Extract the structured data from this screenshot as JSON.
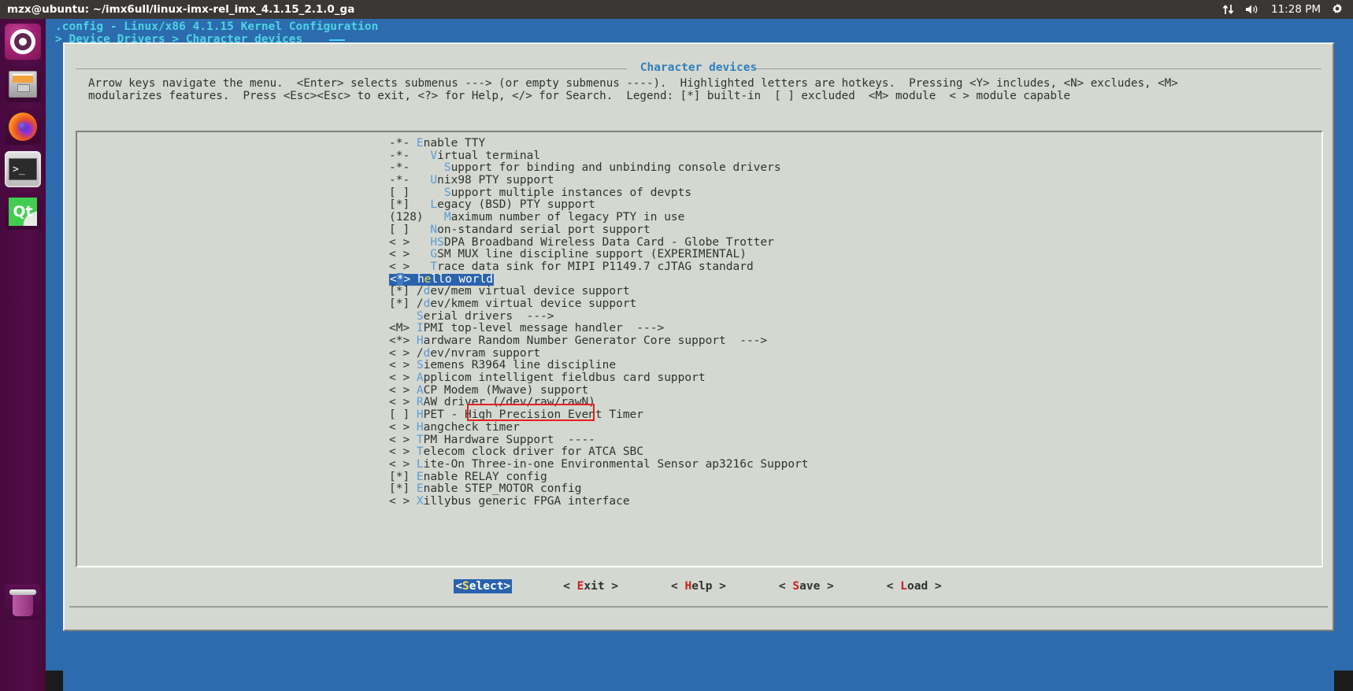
{
  "panel": {
    "window_title": "mzx@ubuntu: ~/imx6ull/linux-imx-rel_imx_4.1.15_2.1.0_ga",
    "clock": "11:28 PM",
    "network_icon": "network-updown-icon",
    "volume_icon": "volume-icon",
    "gear_icon": "gear-icon"
  },
  "launcher": {
    "items": [
      {
        "name": "ubuntu-dash",
        "label": "Ubuntu Dash",
        "icon": "ubuntu-logo-icon",
        "active": false
      },
      {
        "name": "files",
        "label": "Files",
        "icon": "file-cabinet-icon",
        "active": false
      },
      {
        "name": "firefox",
        "label": "Firefox",
        "icon": "firefox-icon",
        "active": false
      },
      {
        "name": "terminal",
        "label": "Terminal",
        "icon": "terminal-icon",
        "active": true,
        "prompt": ">_"
      },
      {
        "name": "qtcreator",
        "label": "Qt Creator",
        "icon": "qt-icon",
        "glyph": "Qt",
        "active": false
      },
      {
        "name": "trash",
        "label": "Trash",
        "icon": "trash-icon",
        "active": false
      }
    ]
  },
  "menuconfig": {
    "title": ".config - Linux/x86 4.1.15 Kernel Configuration",
    "breadcrumb": "> Device Drivers > Character devices",
    "dialog_title": "Character devices",
    "instructions_line1": "Arrow keys navigate the menu.  <Enter> selects submenus ---> (or empty submenus ----).  Highlighted letters are hotkeys.  Pressing <Y> includes, <N> excludes, <M>",
    "instructions_line2": "modularizes features.  Press <Esc><Esc> to exit, <?> for Help, </> for Search.  Legend: [*] built-in  [ ] excluded  <M> module  < > module capable",
    "rows": [
      {
        "flag": "-*- ",
        "indent": "",
        "hot": "E",
        "rest": "nable TTY"
      },
      {
        "flag": "-*- ",
        "indent": "  ",
        "hot": "V",
        "rest": "irtual terminal"
      },
      {
        "flag": "-*- ",
        "indent": "    ",
        "hot": "S",
        "rest": "upport for binding and unbinding console drivers"
      },
      {
        "flag": "-*- ",
        "indent": "  ",
        "hot": "U",
        "rest": "nix98 PTY support"
      },
      {
        "flag": "[ ] ",
        "indent": "    ",
        "hot": "S",
        "rest": "upport multiple instances of devpts"
      },
      {
        "flag": "[*] ",
        "indent": "  ",
        "hot": "L",
        "rest": "egacy (BSD) PTY support"
      },
      {
        "flag": "(128) ",
        "indent": "  ",
        "hot": "M",
        "rest": "aximum number of legacy PTY in use"
      },
      {
        "flag": "[ ] ",
        "indent": "  ",
        "hot": "N",
        "rest": "on-standard serial port support"
      },
      {
        "flag": "< > ",
        "indent": "  ",
        "hot": "HS",
        "rest": "DPA Broadband Wireless Data Card - Globe Trotter"
      },
      {
        "flag": "< > ",
        "indent": "  ",
        "hot": "G",
        "rest": "SM MUX line discipline support (EXPERIMENTAL)"
      },
      {
        "flag": "< > ",
        "indent": "  ",
        "hot": "T",
        "rest": "race data sink for MIPI P1149.7 cJTAG standard"
      },
      {
        "flag": "<*> ",
        "indent": "",
        "hot": "e",
        "pre": "h",
        "rest": "llo world",
        "selected": true,
        "label": "hello world"
      },
      {
        "flag": "[*] ",
        "indent": "",
        "pre": "/",
        "hot": "d",
        "rest": "ev/mem virtual device support"
      },
      {
        "flag": "[*] ",
        "indent": "",
        "pre": "/",
        "hot": "d",
        "rest": "ev/kmem virtual device support"
      },
      {
        "flag": "    ",
        "indent": "",
        "hot": "S",
        "rest": "erial drivers  --->"
      },
      {
        "flag": "<M> ",
        "indent": "",
        "hot": "I",
        "rest": "PMI top-level message handler  --->"
      },
      {
        "flag": "<*> ",
        "indent": "",
        "hot": "H",
        "rest": "ardware Random Number Generator Core support  --->"
      },
      {
        "flag": "< > ",
        "indent": "",
        "pre": "/",
        "hot": "d",
        "rest": "ev/nvram support"
      },
      {
        "flag": "< > ",
        "indent": "",
        "hot": "S",
        "rest": "iemens R3964 line discipline"
      },
      {
        "flag": "< > ",
        "indent": "",
        "hot": "A",
        "rest": "pplicom intelligent fieldbus card support"
      },
      {
        "flag": "< > ",
        "indent": "",
        "hot": "A",
        "rest": "CP Modem (Mwave) support"
      },
      {
        "flag": "< > ",
        "indent": "",
        "hot": "R",
        "rest": "AW driver (/dev/raw/rawN)"
      },
      {
        "flag": "[ ] ",
        "indent": "",
        "hot": "H",
        "rest": "PET - High Precision Event Timer"
      },
      {
        "flag": "< > ",
        "indent": "",
        "hot": "H",
        "rest": "angcheck timer"
      },
      {
        "flag": "< > ",
        "indent": "",
        "hot": "T",
        "rest": "PM Hardware Support  ----"
      },
      {
        "flag": "< > ",
        "indent": "",
        "hot": "T",
        "rest": "elecom clock driver for ATCA SBC"
      },
      {
        "flag": "< > ",
        "indent": "",
        "hot": "L",
        "rest": "ite-On Three-in-one Environmental Sensor ap3216c Support"
      },
      {
        "flag": "[*] ",
        "indent": "",
        "hot": "E",
        "rest": "nable RELAY config"
      },
      {
        "flag": "[*] ",
        "indent": "",
        "hot": "E",
        "rest": "nable STEP_MOTOR config"
      },
      {
        "flag": "< > ",
        "indent": "",
        "hot": "X",
        "rest": "illybus generic FPGA interface"
      }
    ],
    "buttons": [
      {
        "name": "select",
        "open": "<",
        "hot": "S",
        "rest": "elect",
        "close": ">",
        "active": true
      },
      {
        "name": "exit",
        "open": "< ",
        "hot": "E",
        "rest": "xit",
        "close": " >",
        "active": false
      },
      {
        "name": "help",
        "open": "< ",
        "hot": "H",
        "rest": "elp",
        "close": " >",
        "active": false
      },
      {
        "name": "save",
        "open": "< ",
        "hot": "S",
        "rest": "ave",
        "close": " >",
        "active": false
      },
      {
        "name": "load",
        "open": "< ",
        "hot": "L",
        "rest": "oad",
        "close": " >",
        "active": false
      }
    ]
  },
  "colors": {
    "terminal_blue": "#2c6bae",
    "dialog_grey": "#d5d8d0",
    "header_cyan": "#4fd2e3",
    "hotkey_blue": "#5b9bd5",
    "selected_blue": "#2a62ad",
    "selected_hotkey": "#f4e04d",
    "button_hotkey_red": "#c62020",
    "annotation_red": "#e02020",
    "panel_grey": "#3b3735",
    "launcher_purple": "#47093f"
  }
}
